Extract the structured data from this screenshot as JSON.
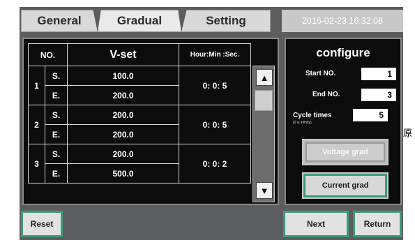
{
  "tabs": {
    "general": "General",
    "gradual": "Gradual",
    "setting": "Setting"
  },
  "datetime": "2016-02-23 16:32:08",
  "table": {
    "headers": {
      "no": "NO.",
      "vset": "V-set",
      "hms": "Hour:Min :Sec."
    },
    "rows": [
      {
        "no": "1",
        "s_label": "S.",
        "e_label": "E.",
        "s_val": "100.0",
        "e_val": "200.0",
        "time": "0:  0:  5"
      },
      {
        "no": "2",
        "s_label": "S.",
        "e_label": "E.",
        "s_val": "200.0",
        "e_val": "200.0",
        "time": "0:  0:  5"
      },
      {
        "no": "3",
        "s_label": "S.",
        "e_label": "E.",
        "s_val": "200.0",
        "e_val": "500.0",
        "time": "0:  0:  2"
      }
    ]
  },
  "configure": {
    "title": "configure",
    "start_label": "Start NO.",
    "start_value": "1",
    "end_label": "End NO.",
    "end_value": "3",
    "cycle_label": "Cycle times",
    "cycle_sub": "(0 is infinity)",
    "cycle_value": "5",
    "voltage_button": "Voltage grad",
    "current_button": "Current grad"
  },
  "buttons": {
    "reset": "Reset",
    "next": "Next",
    "return": "Return"
  },
  "side_char": "原",
  "colors": {
    "button_border": "#3d9a7c",
    "panel_bg": "#0c0c0c",
    "screen_bg": "#5c5d5e"
  }
}
